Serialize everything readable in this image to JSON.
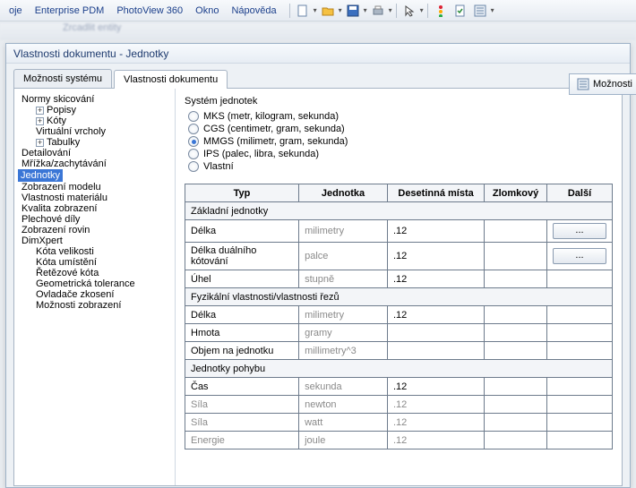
{
  "menubar": {
    "items": [
      "oje",
      "Enterprise PDM",
      "PhotoView 360",
      "Okno",
      "Nápověda"
    ]
  },
  "blurred_secondary": "Zrcadlit entity",
  "dialog": {
    "title": "Vlastnosti dokumentu - Jednotky",
    "tabs": {
      "system": "Možnosti systému",
      "document": "Vlastnosti dokumentu"
    },
    "right_button": "Možnosti"
  },
  "tree": [
    {
      "label": "Normy skicování",
      "indent": 0
    },
    {
      "label": "Popisy",
      "indent": 1,
      "expander": "+"
    },
    {
      "label": "Kóty",
      "indent": 1,
      "expander": "+"
    },
    {
      "label": "Virtuální vrcholy",
      "indent": 1
    },
    {
      "label": "Tabulky",
      "indent": 1,
      "expander": "+"
    },
    {
      "label": "Detailování",
      "indent": 0
    },
    {
      "label": "Mřížka/zachytávání",
      "indent": 0
    },
    {
      "label": "Jednotky",
      "indent": 0,
      "selected": true
    },
    {
      "label": "Zobrazení modelu",
      "indent": 0
    },
    {
      "label": "Vlastnosti materiálu",
      "indent": 0
    },
    {
      "label": "Kvalita zobrazení",
      "indent": 0
    },
    {
      "label": "Plechové díly",
      "indent": 0
    },
    {
      "label": "Zobrazení rovin",
      "indent": 0
    },
    {
      "label": "DimXpert",
      "indent": 0
    },
    {
      "label": "Kóta velikosti",
      "indent": 1
    },
    {
      "label": "Kóta umístění",
      "indent": 1
    },
    {
      "label": "Řetězové kóta",
      "indent": 1
    },
    {
      "label": "Geometrická tolerance",
      "indent": 1
    },
    {
      "label": "Ovladače zkosení",
      "indent": 1
    },
    {
      "label": "Možnosti zobrazení",
      "indent": 1
    }
  ],
  "unit_system": {
    "label": "Systém jednotek",
    "options": [
      {
        "label": "MKS  (metr, kilogram, sekunda)",
        "checked": false
      },
      {
        "label": "CGS  (centimetr, gram, sekunda)",
        "checked": false
      },
      {
        "label": "MMGS  (milimetr, gram, sekunda)",
        "checked": true
      },
      {
        "label": "IPS  (palec, libra, sekunda)",
        "checked": false
      },
      {
        "label": "Vlastní",
        "checked": false
      }
    ]
  },
  "table": {
    "headers": {
      "typ": "Typ",
      "jednotka": "Jednotka",
      "desetinna": "Desetinná místa",
      "zlomkovy": "Zlomkový",
      "dalsi": "Další"
    },
    "sections": [
      {
        "title": "Základní jednotky",
        "rows": [
          {
            "typ": "Délka",
            "jednotka": "milimetry",
            "des": ".12",
            "btn": true
          },
          {
            "typ": "Délka duálního kótování",
            "jednotka": "palce",
            "des": ".12",
            "btn": true
          },
          {
            "typ": "Úhel",
            "jednotka": "stupně",
            "des": ".12",
            "btn": false
          }
        ]
      },
      {
        "title": "Fyzikální vlastnosti/vlastnosti řezů",
        "rows": [
          {
            "typ": "Délka",
            "jednotka": "milimetry",
            "des": ".12"
          },
          {
            "typ": "Hmota",
            "jednotka": "gramy",
            "des": ""
          },
          {
            "typ": "Objem na jednotku",
            "jednotka": "millimetry^3",
            "des": ""
          }
        ]
      },
      {
        "title": "Jednotky pohybu",
        "rows": [
          {
            "typ": "Čas",
            "jednotka": "sekunda",
            "des": ".12"
          },
          {
            "typ": "Síla",
            "jednotka": "newton",
            "des": ".12",
            "dim": true
          },
          {
            "typ": "Síla",
            "jednotka": "watt",
            "des": ".12",
            "dim": true
          },
          {
            "typ": "Energie",
            "jednotka": "joule",
            "des": ".12",
            "dim": true
          }
        ]
      }
    ]
  },
  "ellipsis": "..."
}
